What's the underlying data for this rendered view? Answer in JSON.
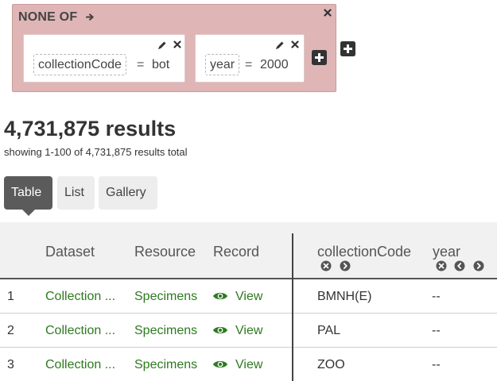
{
  "filter_group": {
    "title": "NONE OF",
    "terms": [
      {
        "field": "collectionCode",
        "operator": "=",
        "value": "bot"
      },
      {
        "field": "year",
        "operator": "=",
        "value": "2000"
      }
    ]
  },
  "results": {
    "count": "4,731,875 results",
    "summary": "showing 1-100 of 4,731,875 results total"
  },
  "tabs": [
    {
      "label": "Table",
      "active": true
    },
    {
      "label": "List",
      "active": false
    },
    {
      "label": "Gallery",
      "active": false
    }
  ],
  "table": {
    "columns": [
      "Dataset",
      "Resource",
      "Record",
      "collectionCode",
      "year"
    ],
    "rows": [
      {
        "index": "1",
        "dataset": "Collection ...",
        "resource": "Specimens",
        "record": "View",
        "collectionCode": "BMNH(E)",
        "year": "--"
      },
      {
        "index": "2",
        "dataset": "Collection ...",
        "resource": "Specimens",
        "record": "View",
        "collectionCode": "PAL",
        "year": "--"
      },
      {
        "index": "3",
        "dataset": "Collection ...",
        "resource": "Specimens",
        "record": "View",
        "collectionCode": "ZOO",
        "year": "--"
      }
    ]
  },
  "icons": {
    "filter_arrow": "arrow-right-icon",
    "close": "close-icon",
    "edit": "pencil-icon",
    "delete": "close-icon",
    "add": "plus-square-icon",
    "view": "eye-icon",
    "remove_column": "circle-x-icon",
    "move_left": "circle-chevron-left-icon",
    "move_right": "circle-chevron-right-icon"
  },
  "colors": {
    "filter_background": "#dfb5b5",
    "link_green": "#2d7a1f",
    "active_tab": "#5b5b5b",
    "inactive_tab": "#ededed",
    "table_header": "#f1f1f1"
  }
}
